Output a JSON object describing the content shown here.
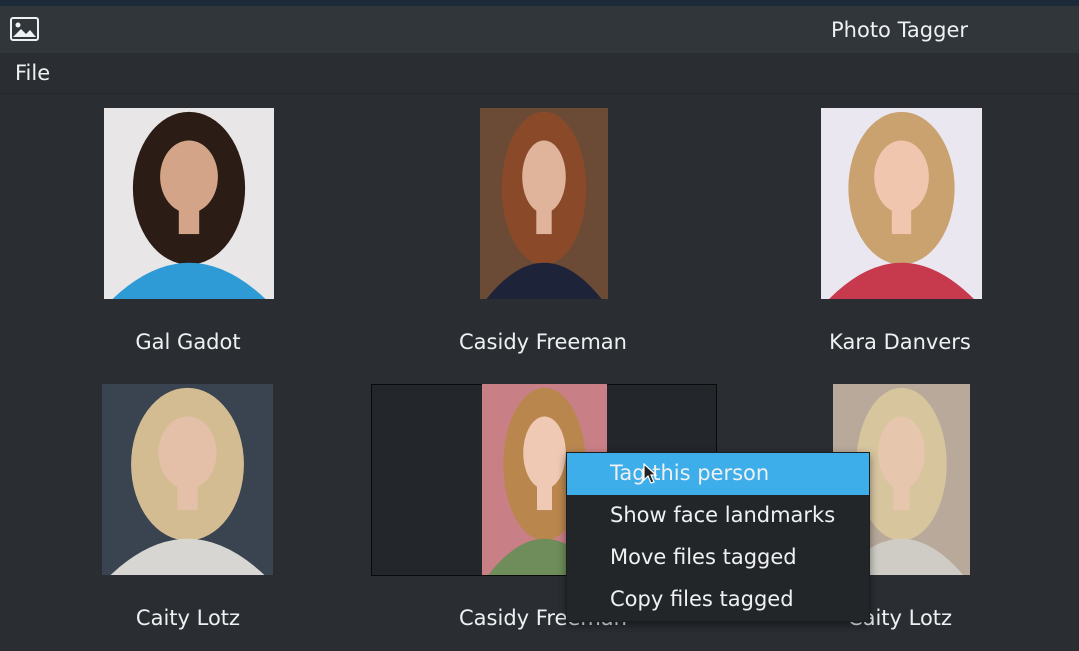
{
  "window": {
    "title": "Photo Tagger",
    "app_icon": "image-icon"
  },
  "menu": {
    "file_label": "File"
  },
  "photos": [
    {
      "name": "Gal Gadot",
      "bg": "#e8e6e6",
      "hair": "#2b1d16",
      "skin": "#d3a488",
      "top": "#2f9bd6"
    },
    {
      "name": "Casidy Freeman",
      "bg": "#6b4a36",
      "hair": "#8a4a2a",
      "skin": "#e0b49a",
      "top": "#1d2338"
    },
    {
      "name": "Kara Danvers",
      "bg": "#ebe7f0",
      "hair": "#c9a270",
      "skin": "#f0c6ae",
      "top": "#c73a4d"
    },
    {
      "name": "Caity Lotz",
      "bg": "#3a4350",
      "hair": "#d4bc92",
      "skin": "#e3c0a7",
      "top": "#d8d6d2"
    },
    {
      "name": "Casidy Freeman",
      "bg": "#c97f86",
      "hair": "#b9874e",
      "skin": "#efc9b3",
      "top": "#6e8d5a"
    },
    {
      "name": "Caity Lotz",
      "bg": "#b8a99a",
      "hair": "#d7c59e",
      "skin": "#e6c7ad",
      "top": "#cfcbc5"
    }
  ],
  "context_menu": {
    "items": [
      {
        "label": "Tag this person",
        "active": true
      },
      {
        "label": "Show face landmarks",
        "active": false
      },
      {
        "label": "Move files tagged",
        "active": false
      },
      {
        "label": "Copy files tagged",
        "active": false
      }
    ]
  }
}
